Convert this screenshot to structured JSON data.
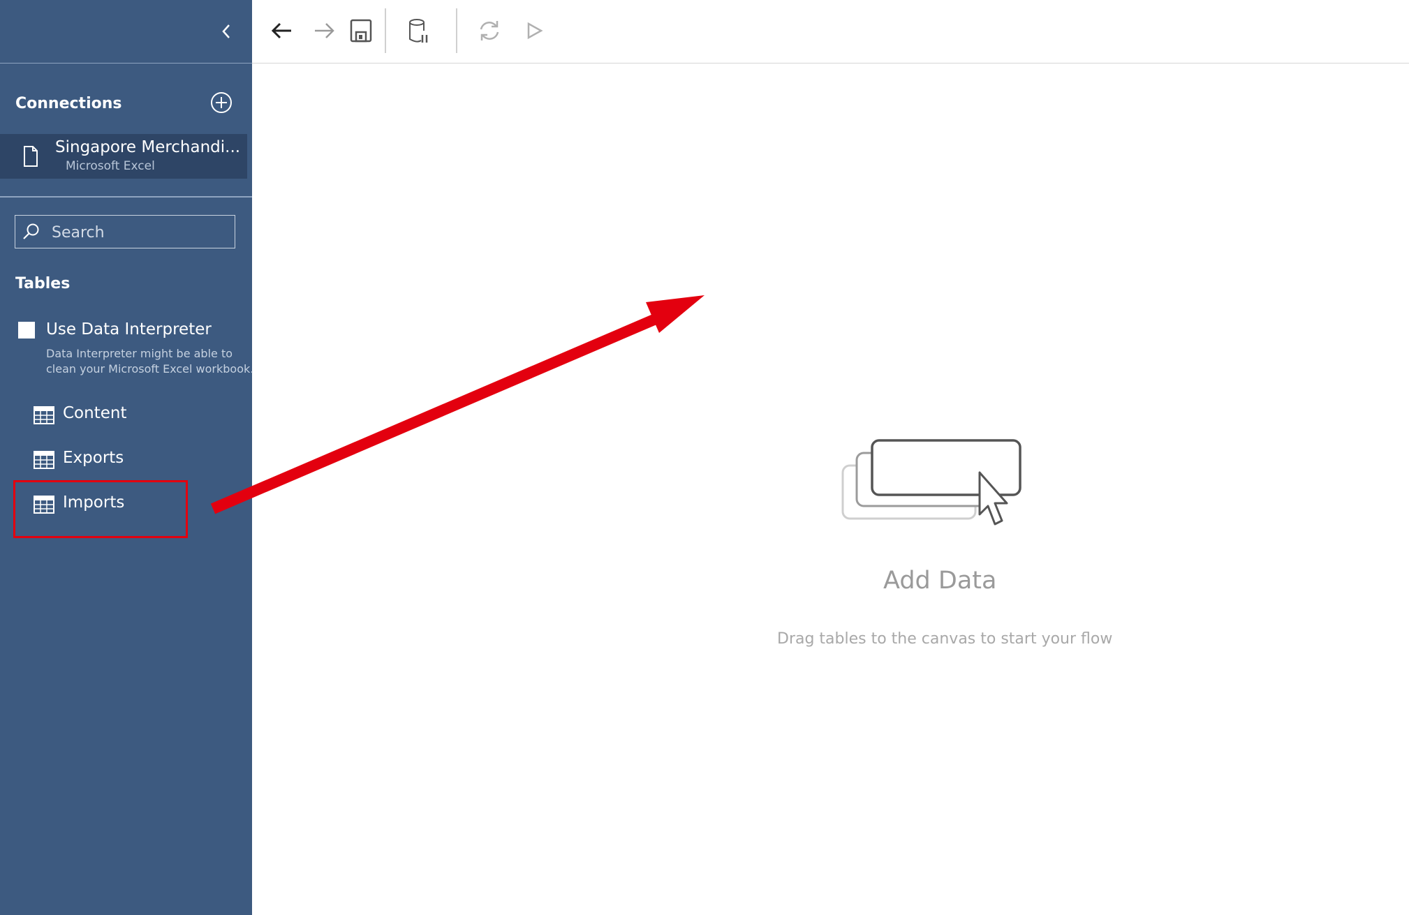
{
  "sidebar": {
    "connections_title": "Connections",
    "connection": {
      "name": "Singapore Merchandi...",
      "type": "Microsoft Excel"
    },
    "search": {
      "placeholder": "Search"
    },
    "tables_title": "Tables",
    "data_interpreter": {
      "label": "Use Data Interpreter",
      "checked": false,
      "description_line1": "Data Interpreter might be able to",
      "description_line2": "clean your Microsoft Excel workbook."
    },
    "tables": [
      {
        "label": "Content"
      },
      {
        "label": "Exports"
      },
      {
        "label": "Imports"
      }
    ]
  },
  "toolbar": {
    "buttons": [
      "back-icon",
      "forward-icon",
      "save-icon",
      "data-pause-icon",
      "refresh-icon",
      "run-icon"
    ]
  },
  "canvas": {
    "title": "Add Data",
    "hint": "Drag tables to the canvas to start your flow"
  },
  "annotation": {
    "highlight_target": "Imports",
    "arrow_color": "#e3000f"
  },
  "colors": {
    "sidebar_bg": "#3d5a80",
    "selected_connection_bg": "#2e4566",
    "annotation_red": "#e3000f"
  }
}
